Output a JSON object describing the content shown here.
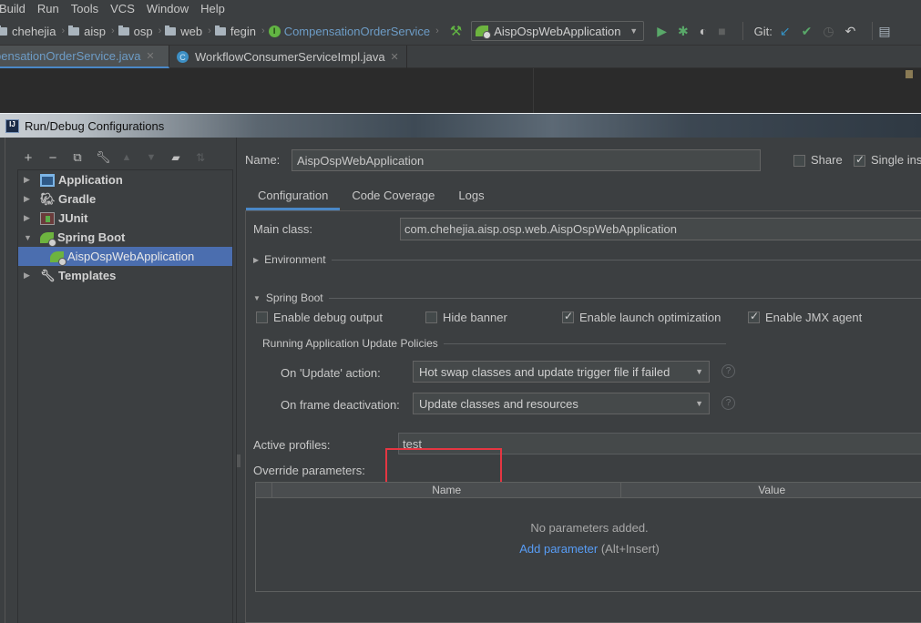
{
  "menubar": {
    "items": [
      "Build",
      "Run",
      "Tools",
      "VCS",
      "Window",
      "Help"
    ]
  },
  "navbar": {
    "breadcrumbs": [
      "chehejia",
      "aisp",
      "osp",
      "web",
      "fegin"
    ],
    "current_class": "CompensationOrderService",
    "run_config": "AispOspWebApplication",
    "git_label": "Git:"
  },
  "editor_tabs": [
    {
      "label": "CompensationOrderService.java",
      "visible_label": "pensationOrderService.java",
      "active": true
    },
    {
      "label": "WorkflowConsumerServiceImpl.java",
      "active": false
    }
  ],
  "dialog": {
    "title": "Run/Debug Configurations",
    "toolbar": [
      "add",
      "remove",
      "copy",
      "edit-defaults",
      "move-up",
      "move-down",
      "new-folder",
      "sort"
    ],
    "tree": [
      {
        "label": "Application",
        "icon": "application-icon",
        "expanded": false
      },
      {
        "label": "Gradle",
        "icon": "gradle-icon",
        "expanded": false
      },
      {
        "label": "JUnit",
        "icon": "junit-icon",
        "expanded": false
      },
      {
        "label": "Spring Boot",
        "icon": "spring-boot-icon",
        "expanded": true,
        "children": [
          {
            "label": "AispOspWebApplication",
            "selected": true
          }
        ]
      },
      {
        "label": "Templates",
        "icon": "wrench-icon",
        "expanded": false
      }
    ],
    "name_label": "Name:",
    "name_value": "AispOspWebApplication",
    "share_label": "Share",
    "share_checked": false,
    "single_instance_label": "Single instance only",
    "single_instance_visible": "Single ins",
    "single_instance_checked": true,
    "tabs": [
      "Configuration",
      "Code Coverage",
      "Logs"
    ],
    "active_tab": "Configuration",
    "config": {
      "main_class_label": "Main class:",
      "main_class_value": "com.chehejia.aisp.osp.web.AispOspWebApplication",
      "environment_label": "Environment",
      "spring_boot_label": "Spring Boot",
      "options": [
        {
          "label": "Enable debug output",
          "checked": false
        },
        {
          "label": "Hide banner",
          "checked": false
        },
        {
          "label": "Enable launch optimization",
          "checked": true
        },
        {
          "label": "Enable JMX agent",
          "checked": true
        }
      ],
      "update_policies_label": "Running Application Update Policies",
      "on_update_label": "On 'Update' action:",
      "on_update_value": "Hot swap classes and update trigger file if failed",
      "on_frame_label": "On frame deactivation:",
      "on_frame_value": "Update classes and resources",
      "active_profiles_label": "Active profiles:",
      "active_profiles_value": "test",
      "override_label": "Override parameters:",
      "table_headers": [
        "Name",
        "Value"
      ],
      "empty_message": "No parameters added.",
      "add_parameter_link": "Add parameter",
      "add_parameter_shortcut": "(Alt+Insert)"
    }
  },
  "colors": {
    "accent": "#4a88c7",
    "selection": "#4b6eaf",
    "link": "#589df6",
    "highlight_box": "#e53642",
    "spring_green": "#6db33f"
  }
}
